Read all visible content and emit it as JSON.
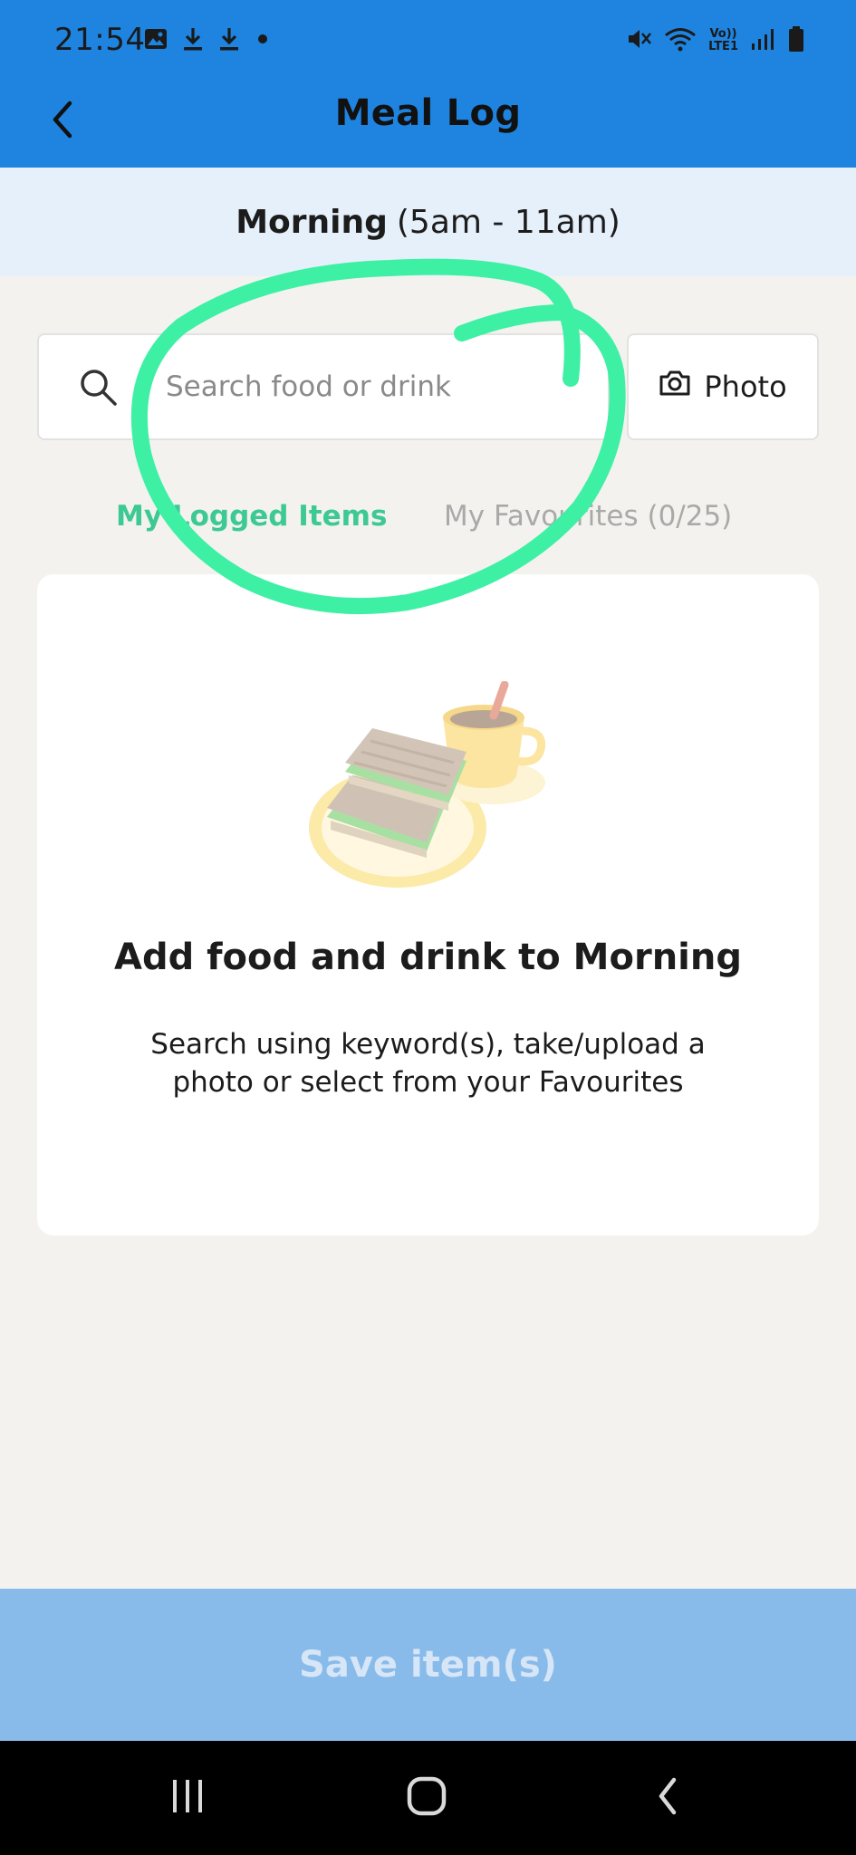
{
  "status_bar": {
    "time": "21:54",
    "left_icons": [
      "image-icon",
      "download-icon",
      "download-icon",
      "dot-icon"
    ],
    "right_icons": [
      "mute-icon",
      "wifi-icon",
      "volte-icon",
      "signal-icon",
      "battery-icon"
    ],
    "volte_text_top": "Vo))",
    "volte_text_bottom": "LTE1"
  },
  "app_bar": {
    "title": "Meal Log",
    "back_icon": "chevron-left-icon"
  },
  "period": {
    "name": "Morning",
    "range": "(5am - 11am)"
  },
  "search": {
    "placeholder": "Search food or drink",
    "value": "",
    "icon": "search-icon"
  },
  "photo_button": {
    "label": "Photo",
    "icon": "camera-icon"
  },
  "tabs": [
    {
      "label": "My Logged Items",
      "active": true
    },
    {
      "label": "My Favourites (0/25)",
      "active": false
    }
  ],
  "empty_state": {
    "title": "Add food and drink to Morning",
    "subtitle": "Search using keyword(s), take/upload a photo or select from your Favourites",
    "illustration": "toast-and-coffee-illustration"
  },
  "save_button": {
    "label": "Save item(s)",
    "enabled": false
  },
  "nav_bar": {
    "items": [
      "recents-icon",
      "home-icon",
      "back-icon"
    ]
  },
  "colors": {
    "header": "#1e84e0",
    "period_bar": "#e6f0fb",
    "active_tab": "#3cc992",
    "inactive_tab": "#a9a9a9",
    "save_bar": "#89bbea",
    "annotation": "#3ef0a4"
  }
}
